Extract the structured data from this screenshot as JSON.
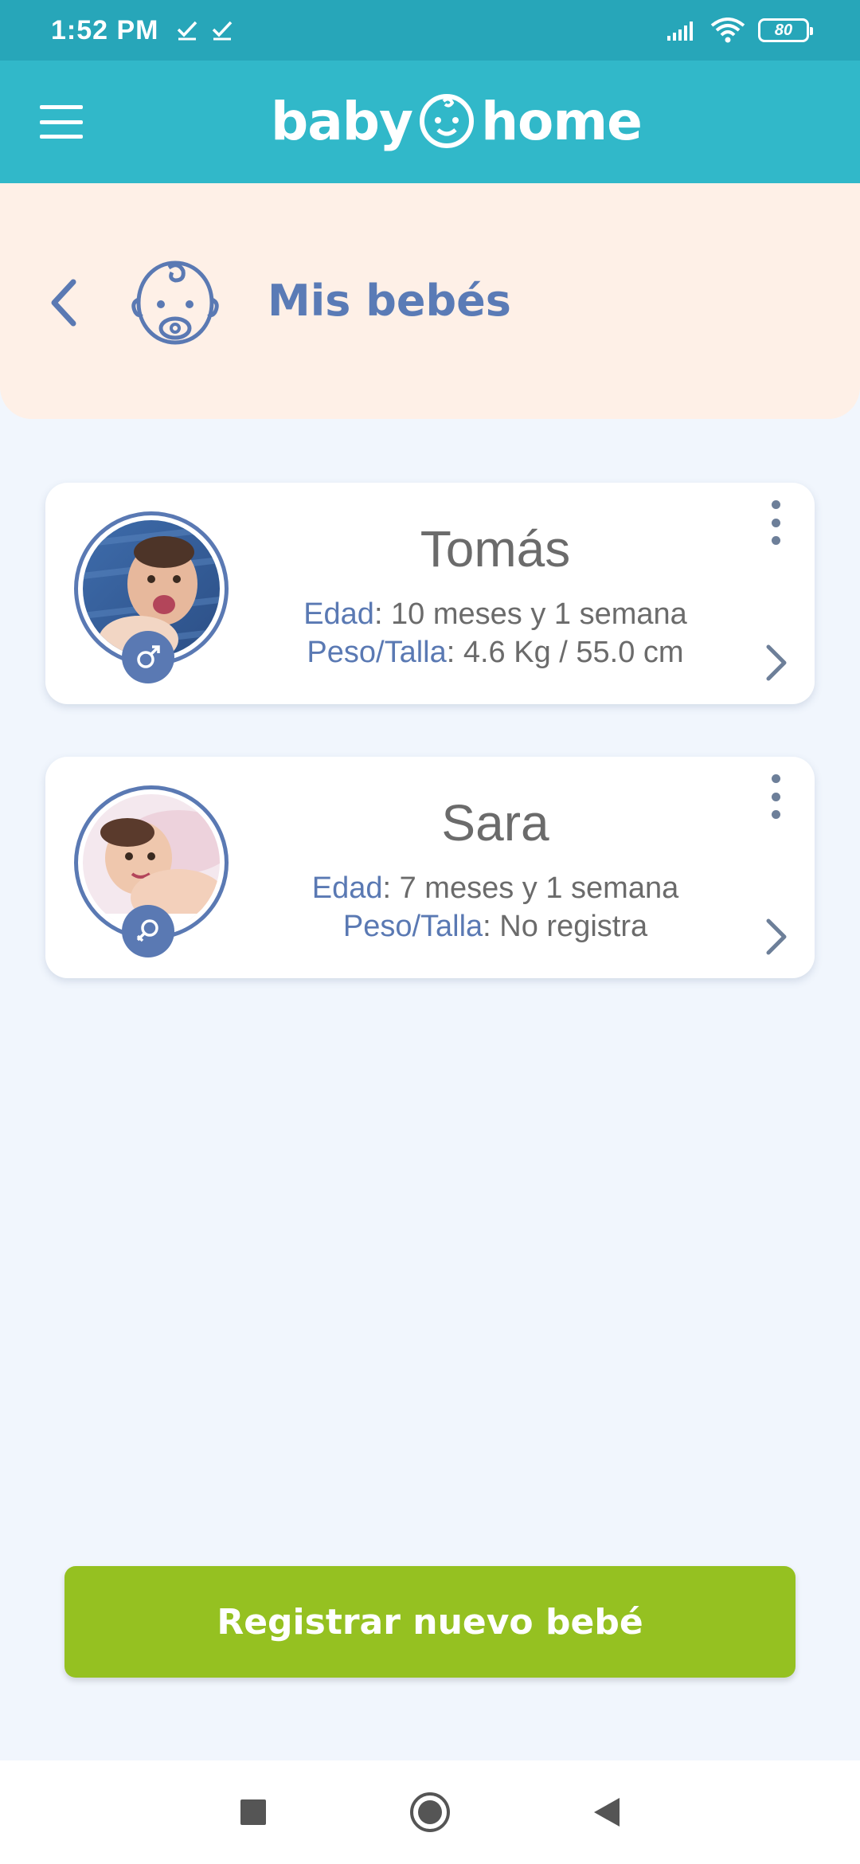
{
  "status_bar": {
    "time": "1:52 PM",
    "battery": "80",
    "icons": [
      "check-icon",
      "check-icon",
      "signal-icon",
      "wifi-icon",
      "battery-icon"
    ]
  },
  "app_bar": {
    "logo_left": "baby",
    "logo_right": "home",
    "menu_icon": "hamburger-menu-icon"
  },
  "header": {
    "title": "Mis bebés",
    "back_icon": "chevron-left-icon",
    "baby_icon": "baby-face-icon"
  },
  "babies": [
    {
      "name": "Tomás",
      "age_label": "Edad",
      "age_value": ": 10 meses y 1 semana",
      "weight_label": "Peso/Talla",
      "weight_value": ": 4.6 Kg / 55.0 cm",
      "gender_icon": "male-symbol-icon"
    },
    {
      "name": "Sara",
      "age_label": "Edad",
      "age_value": ": 7 meses y 1 semana",
      "weight_label": "Peso/Talla",
      "weight_value": ": No registra",
      "gender_icon": "female-symbol-icon"
    }
  ],
  "cta": {
    "label": "Registrar nuevo bebé"
  },
  "colors": {
    "status_bar": "#27a6b9",
    "app_bar": "#31b8c9",
    "header_panel": "#fef0e7",
    "background": "#f1f6fd",
    "accent_blue": "#5a79b3",
    "cta_green": "#95c121"
  },
  "nav_bar": {
    "icons": [
      "recents-square-icon",
      "home-circle-icon",
      "back-triangle-icon"
    ]
  }
}
